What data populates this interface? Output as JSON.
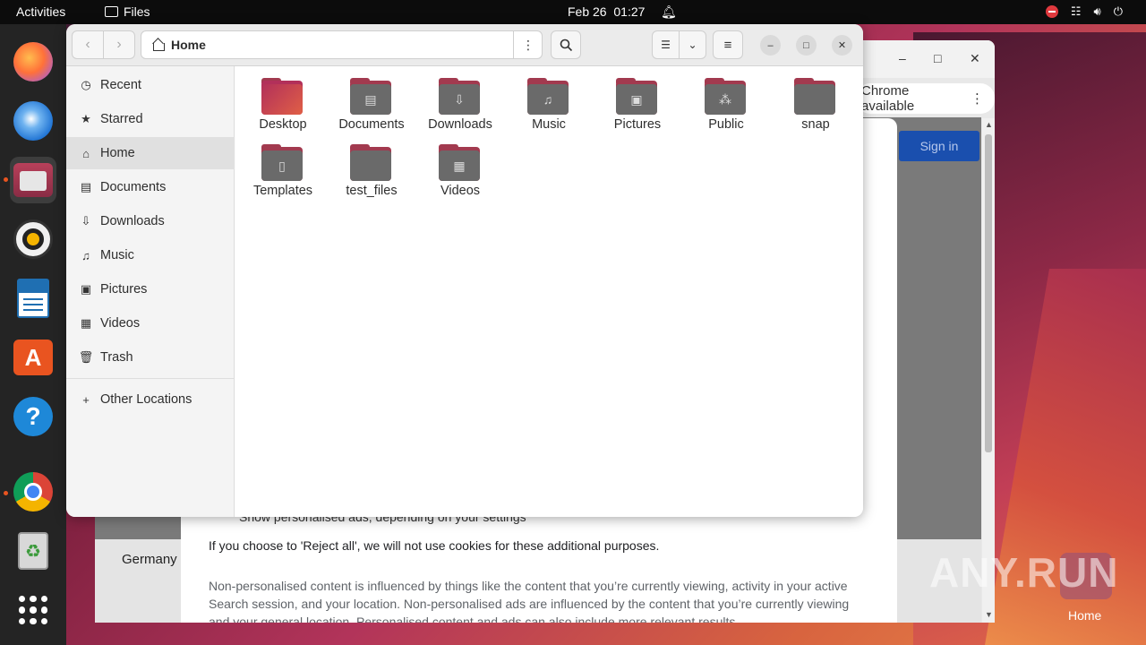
{
  "topbar": {
    "activities": "Activities",
    "app_name": "Files",
    "date": "Feb 26",
    "time": "01:27"
  },
  "dock": {
    "apps": [
      "firefox-icon",
      "thunderbird-icon",
      "files-icon",
      "rhythmbox-icon",
      "libreoffice-writer-icon",
      "app-center-icon",
      "help-icon",
      "chrome-icon",
      "trash-icon",
      "show-apps-icon"
    ]
  },
  "background_window": {
    "chrome_banner": "Chrome available",
    "sign_in": "Sign in",
    "footer_country": "Germany",
    "dialog": {
      "line1": "Show personalised ads, depending on your settings",
      "line2": "If you choose to 'Reject all', we will not use cookies for these additional purposes.",
      "line3": "Non-personalised content is influenced by things like the content that you’re currently viewing, activity in your active Search session, and your location. Non-personalised ads are influenced by the content that you’re currently viewing and your general location. Personalised content and ads can also include more relevant results,"
    }
  },
  "watermark": "ANY.RUN",
  "desktop": {
    "home_label": "Home"
  },
  "files": {
    "path": "Home",
    "sidebar": [
      {
        "label": "Recent",
        "icon": "clock-icon"
      },
      {
        "label": "Starred",
        "icon": "star-icon"
      },
      {
        "label": "Home",
        "icon": "home-icon",
        "selected": true
      },
      {
        "label": "Documents",
        "icon": "document-icon"
      },
      {
        "label": "Downloads",
        "icon": "download-icon"
      },
      {
        "label": "Music",
        "icon": "music-icon"
      },
      {
        "label": "Pictures",
        "icon": "picture-icon"
      },
      {
        "label": "Videos",
        "icon": "video-icon"
      },
      {
        "label": "Trash",
        "icon": "trash-icon"
      }
    ],
    "other_locations": "Other Locations",
    "folders": [
      {
        "name": "Desktop"
      },
      {
        "name": "Documents"
      },
      {
        "name": "Downloads"
      },
      {
        "name": "Music"
      },
      {
        "name": "Pictures"
      },
      {
        "name": "Public"
      },
      {
        "name": "snap"
      },
      {
        "name": "Templates"
      },
      {
        "name": "test_files"
      },
      {
        "name": "Videos"
      }
    ]
  }
}
